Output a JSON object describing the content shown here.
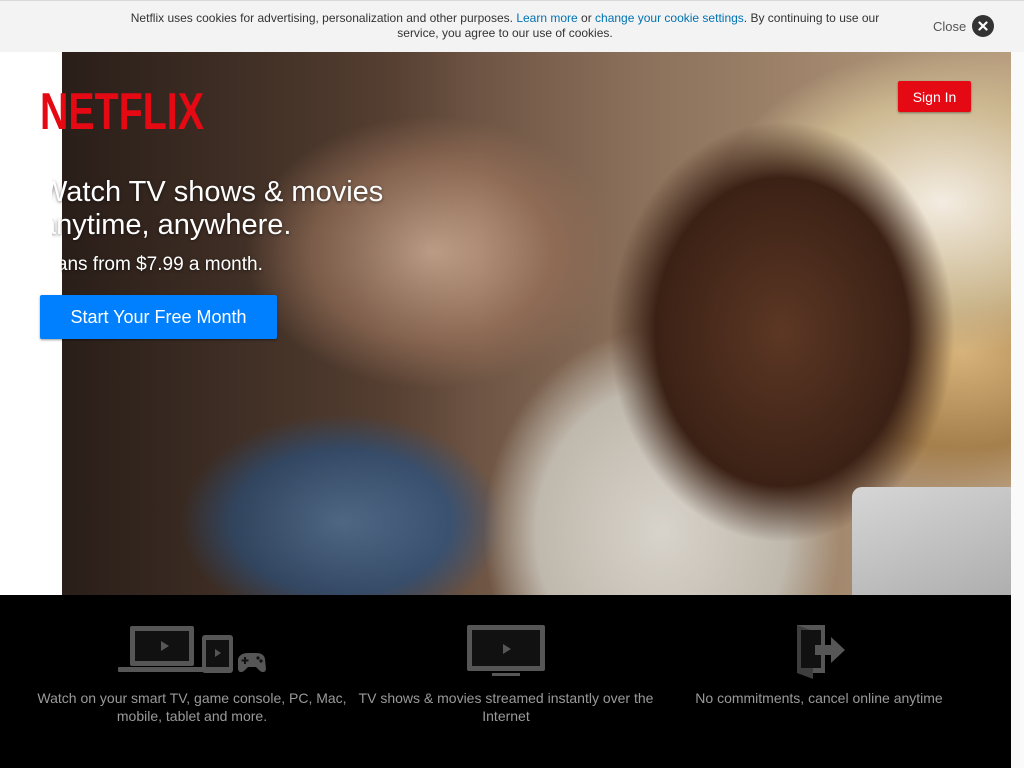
{
  "cookie_banner": {
    "text_before": "Netflix uses cookies for advertising, personalization and other purposes. ",
    "learn_more": "Learn more",
    "text_or": " or ",
    "change_settings": "change your cookie settings",
    "text_after": ". By continuing to use our service, you agree to our use of cookies.",
    "close_label": "Close"
  },
  "header": {
    "logo_text": "NETFLIX",
    "sign_in_label": "Sign In"
  },
  "hero": {
    "headline_line1": "Watch TV shows & movies",
    "headline_line2": "anytime, anywhere.",
    "price_text": "Plans from $7.99 a month.",
    "cta_label": "Start Your Free Month"
  },
  "features": [
    {
      "icon": "devices-icon",
      "text": "Watch on your smart TV, game console, PC, Mac, mobile, tablet and more."
    },
    {
      "icon": "tv-icon",
      "text": "TV shows & movies streamed instantly over the Internet"
    },
    {
      "icon": "exit-door-icon",
      "text": "No commitments, cancel online anytime"
    }
  ],
  "colors": {
    "brand_red": "#e50914",
    "cta_blue": "#0080ff",
    "link_blue": "#0073b1",
    "feature_bg": "#000000"
  }
}
